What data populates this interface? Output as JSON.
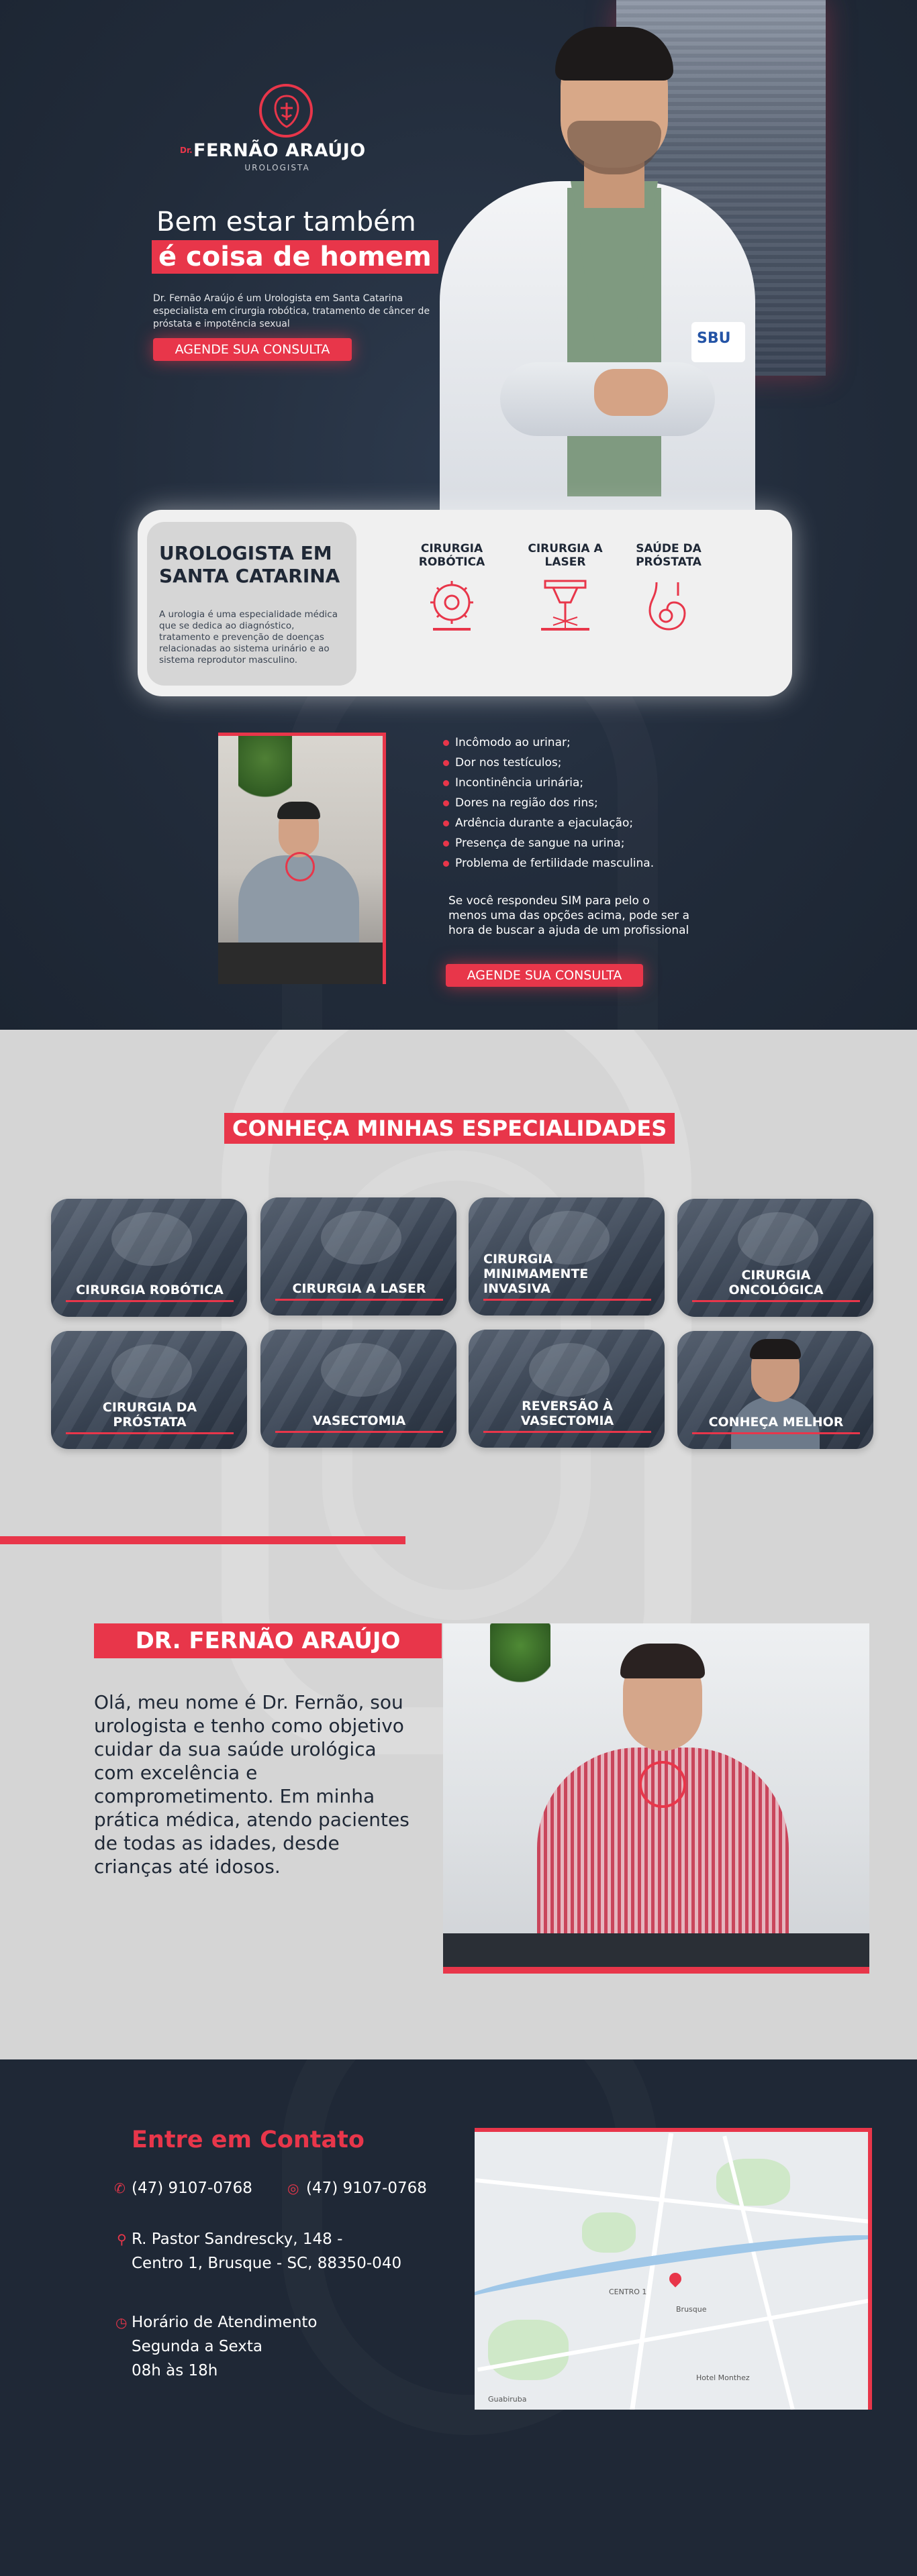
{
  "hero": {
    "logo_prefix": "Dr.",
    "logo_name": "FERNÃO ARAÚJO",
    "logo_sub": "UROLOGISTA",
    "title": "Bem estar também",
    "title_highlight": "é coisa de homem",
    "description": "Dr. Fernão Araújo é um Urologista em Santa Catarina especialista em cirurgia robótica, tratamento de câncer de próstata e impotência sexual",
    "cta": "AGENDE SUA CONSULTA",
    "coat_patch": "SBU"
  },
  "card": {
    "title": "UROLOGISTA EM SANTA CATARINA",
    "text": "A urologia é uma especialidade médica que se dedica ao diagnóstico, tratamento e prevenção de doenças relacionadas ao sistema urinário e ao sistema reprodutor masculino.",
    "services": [
      {
        "label": "CIRURGIA ROBÓTICA",
        "icon": "robotic-surgery-icon"
      },
      {
        "label": "CIRURGIA A LASER",
        "icon": "laser-surgery-icon"
      },
      {
        "label": "SAÚDE DA PRÓSTATA",
        "icon": "prostate-icon"
      }
    ]
  },
  "symptoms": {
    "items": [
      "Incômodo ao urinar;",
      "Dor nos testículos;",
      "Incontinência urinária;",
      "Dores na região dos rins;",
      "Ardência durante a ejaculação;",
      "Presença de sangue na urina;",
      "Problema de fertilidade masculina."
    ],
    "question": "Se você respondeu SIM para pelo o menos uma das opções acima, pode ser a hora de buscar a ajuda de um profissional",
    "cta": "AGENDE SUA CONSULTA"
  },
  "specialties": {
    "title": "CONHEÇA MINHAS ESPECIALIDADES",
    "tiles": [
      "CIRURGIA ROBÓTICA",
      "CIRURGIA A LASER",
      "CIRURGIA MINIMAMENTE INVASIVA",
      "CIRURGIA ONCOLÓGICA",
      "CIRURGIA DA PRÓSTATA",
      "VASECTOMIA",
      "REVERSÃO À VASECTOMIA",
      "CONHEÇA MELHOR"
    ]
  },
  "about": {
    "title": "DR. FERNÃO ARAÚJO",
    "text": "Olá, meu nome é Dr. Fernão, sou urologista e tenho como objetivo cuidar da sua saúde urológica com excelência e comprometimento. Em minha prática médica, atendo pacientes de todas as idades, desde crianças até idosos."
  },
  "contact": {
    "title": "Entre em Contato",
    "phone": "(47) 9107-0768",
    "whatsapp": "(47) 9107-0768",
    "address_line1": "R. Pastor Sandrescky, 148 -",
    "address_line2": "Centro 1, Brusque - SC, 88350-040",
    "hours_title": "Horário de Atendimento",
    "hours_days": "Segunda a Sexta",
    "hours_time": "08h às 18h",
    "map_labels": [
      "Brusque",
      "CENTRO 1",
      "Guabiruba",
      "Hotel Monthez"
    ]
  },
  "colors": {
    "accent": "#e8364a",
    "navy": "#1f2836",
    "light": "#d5d5d5"
  }
}
